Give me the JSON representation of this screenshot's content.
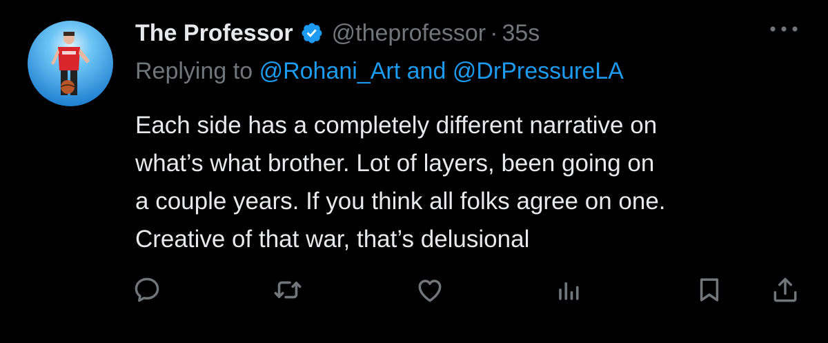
{
  "tweet": {
    "display_name": "The Professor",
    "handle": "@theprofessor",
    "separator": "·",
    "time": "35s",
    "replying_prefix": "Replying to",
    "mention_1": "@Rohani_Art",
    "and_text": "and",
    "mention_2": "@DrPressureLA",
    "text_lines": [
      "Each side has a completely different narrative on",
      "what’s what brother. Lot of layers, been going on",
      "a couple years. If you think all folks agree on one.",
      "Creative of that war, that’s delusional"
    ]
  },
  "actions": [
    {
      "name": "reply",
      "icon": "reply-icon"
    },
    {
      "name": "retweet",
      "icon": "retweet-icon"
    },
    {
      "name": "like",
      "icon": "heart-icon"
    },
    {
      "name": "views",
      "icon": "views-icon"
    },
    {
      "name": "bookmark",
      "icon": "bookmark-icon"
    },
    {
      "name": "share",
      "icon": "share-icon"
    }
  ],
  "colors": {
    "background": "#000000",
    "text": "#e7e9ea",
    "muted": "#71767b",
    "link": "#1d9bf0",
    "verified": "#1d9bf0"
  }
}
